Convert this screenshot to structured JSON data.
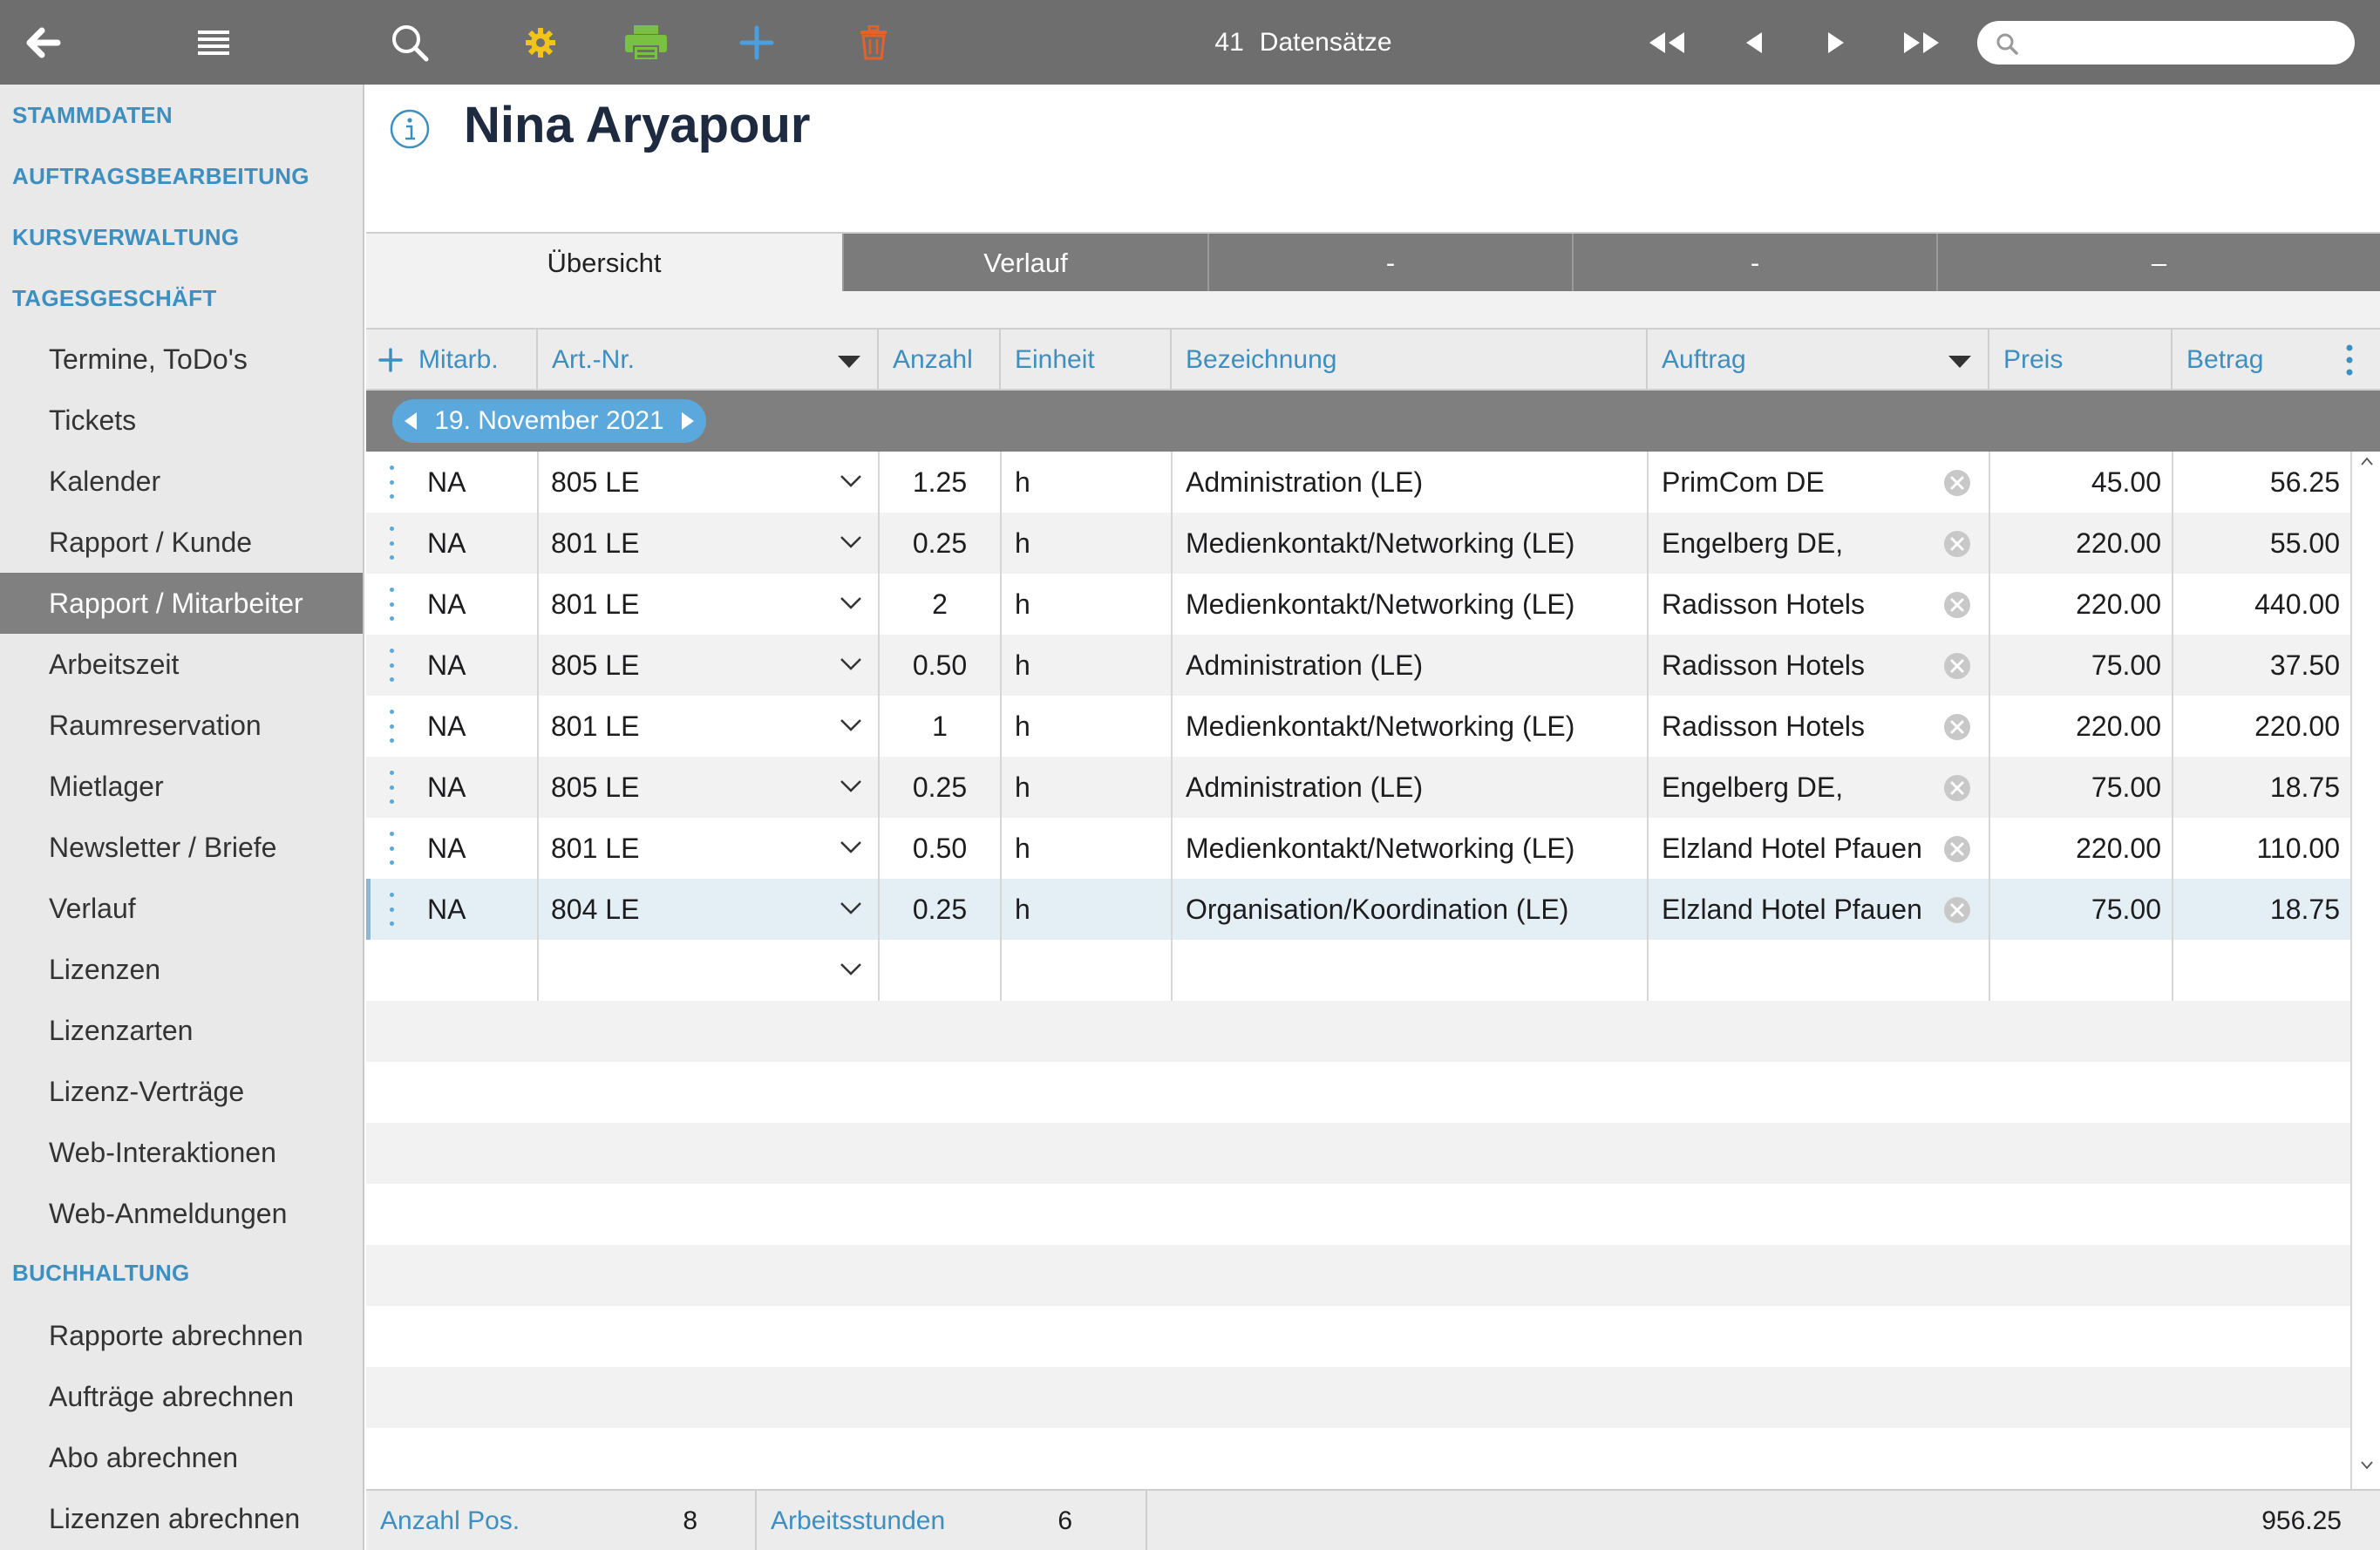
{
  "toolbar": {
    "back_icon": "arrow-left-icon",
    "menu_icon": "hamburger-icon",
    "search_icon": "magnifier-icon",
    "settings_icon": "gear-icon",
    "print_icon": "printer-icon",
    "add_icon": "plus-icon",
    "delete_icon": "trash-icon",
    "record_count": "41",
    "record_label": "Datensätze",
    "search_placeholder": "",
    "colors": {
      "settings": "#f2c31b",
      "print": "#7ac143",
      "add": "#4a9fe0",
      "delete": "#e2622a"
    }
  },
  "sidebar": {
    "sections": [
      {
        "label": "STAMMDATEN"
      },
      {
        "label": "AUFTRAGSBEARBEITUNG"
      },
      {
        "label": "KURSVERWALTUNG"
      },
      {
        "label": "TAGESGESCHÄFT"
      },
      {
        "label": "BUCHHALTUNG"
      }
    ],
    "items": [
      {
        "label": "Termine, ToDo's"
      },
      {
        "label": "Tickets"
      },
      {
        "label": "Kalender"
      },
      {
        "label": "Rapport / Kunde"
      },
      {
        "label": "Rapport / Mitarbeiter",
        "active": true
      },
      {
        "label": "Arbeitszeit"
      },
      {
        "label": "Raumreservation"
      },
      {
        "label": "Mietlager"
      },
      {
        "label": "Newsletter / Briefe"
      },
      {
        "label": "Verlauf"
      },
      {
        "label": "Lizenzen"
      },
      {
        "label": "Lizenzarten"
      },
      {
        "label": "Lizenz-Verträge"
      },
      {
        "label": "Web-Interaktionen"
      },
      {
        "label": "Web-Anmeldungen"
      }
    ],
    "accounting_items": [
      {
        "label": "Rapporte abrechnen"
      },
      {
        "label": "Aufträge abrechnen"
      },
      {
        "label": "Abo abrechnen"
      },
      {
        "label": "Lizenzen abrechnen"
      }
    ]
  },
  "header": {
    "title": "Nina Aryapour",
    "info_icon": "info-icon"
  },
  "tabs": [
    {
      "label": "Übersicht",
      "active": true
    },
    {
      "label": "Verlauf"
    },
    {
      "label": "-"
    },
    {
      "label": "-"
    },
    {
      "label": "–"
    }
  ],
  "table": {
    "columns": {
      "mitarb": "Mitarb.",
      "artnr": "Art.-Nr.",
      "anzahl": "Anzahl",
      "einheit": "Einheit",
      "bezeichnung": "Bezeichnung",
      "auftrag": "Auftrag",
      "preis": "Preis",
      "betrag": "Betrag"
    },
    "date_group": "19. November 2021",
    "rows": [
      {
        "mitarb": "NA",
        "artnr": "805 LE",
        "anzahl": "1.25",
        "einheit": "h",
        "bezeichnung": "Administration (LE)",
        "auftrag": "PrimCom DE",
        "preis": "45.00",
        "betrag": "56.25"
      },
      {
        "mitarb": "NA",
        "artnr": "801 LE",
        "anzahl": "0.25",
        "einheit": "h",
        "bezeichnung": "Medienkontakt/Networking (LE)",
        "auftrag": "Engelberg DE,",
        "preis": "220.00",
        "betrag": "55.00"
      },
      {
        "mitarb": "NA",
        "artnr": "801 LE",
        "anzahl": "2",
        "einheit": "h",
        "bezeichnung": "Medienkontakt/Networking (LE)",
        "auftrag": "Radisson Hotels",
        "preis": "220.00",
        "betrag": "440.00"
      },
      {
        "mitarb": "NA",
        "artnr": "805 LE",
        "anzahl": "0.50",
        "einheit": "h",
        "bezeichnung": "Administration (LE)",
        "auftrag": "Radisson Hotels",
        "preis": "75.00",
        "betrag": "37.50"
      },
      {
        "mitarb": "NA",
        "artnr": "801 LE",
        "anzahl": "1",
        "einheit": "h",
        "bezeichnung": "Medienkontakt/Networking (LE)",
        "auftrag": "Radisson Hotels",
        "preis": "220.00",
        "betrag": "220.00"
      },
      {
        "mitarb": "NA",
        "artnr": "805 LE",
        "anzahl": "0.25",
        "einheit": "h",
        "bezeichnung": "Administration (LE)",
        "auftrag": "Engelberg DE,",
        "preis": "75.00",
        "betrag": "18.75"
      },
      {
        "mitarb": "NA",
        "artnr": "801 LE",
        "anzahl": "0.50",
        "einheit": "h",
        "bezeichnung": "Medienkontakt/Networking (LE)",
        "auftrag": "Elzland Hotel Pfauen",
        "preis": "220.00",
        "betrag": "110.00"
      },
      {
        "mitarb": "NA",
        "artnr": "804 LE",
        "anzahl": "0.25",
        "einheit": "h",
        "bezeichnung": "Organisation/Koordination (LE)",
        "auftrag": "Elzland Hotel Pfauen",
        "preis": "75.00",
        "betrag": "18.75",
        "selected": true
      }
    ]
  },
  "footer": {
    "count_label": "Anzahl Pos.",
    "count_value": "8",
    "hours_label": "Arbeitsstunden",
    "hours_value": "6",
    "total": "956.25"
  }
}
